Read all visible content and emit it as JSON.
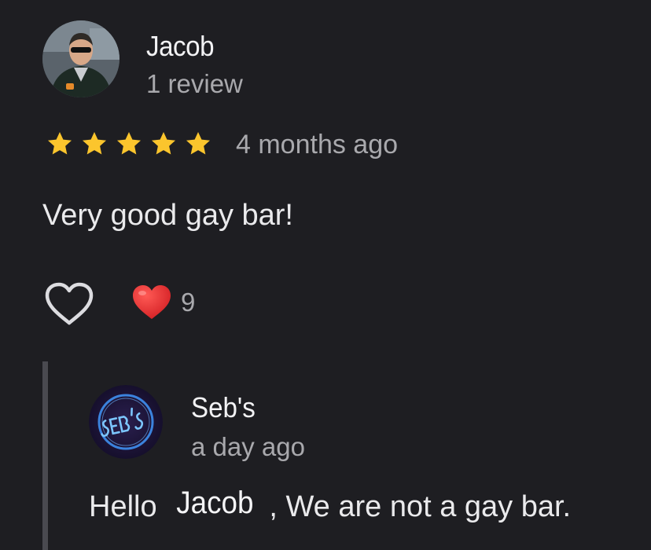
{
  "review": {
    "author": "Jacob",
    "review_count": "1 review",
    "rating": 5,
    "time": "4 months ago",
    "text": "Very good gay bar!",
    "like_icon": "heart-outline-icon",
    "reaction_icon": "red-heart-emoji-icon",
    "reaction_count": "9"
  },
  "reply": {
    "owner_name": "Seb's",
    "time": "a day ago",
    "text_prefix": "Hello",
    "mention": "Jacob",
    "text_suffix": ", We are not a gay bar."
  },
  "colors": {
    "background": "#1e1e22",
    "star": "#fbc52d",
    "reaction_heart": "#e0282c",
    "secondary_text": "#a9a9ad"
  }
}
